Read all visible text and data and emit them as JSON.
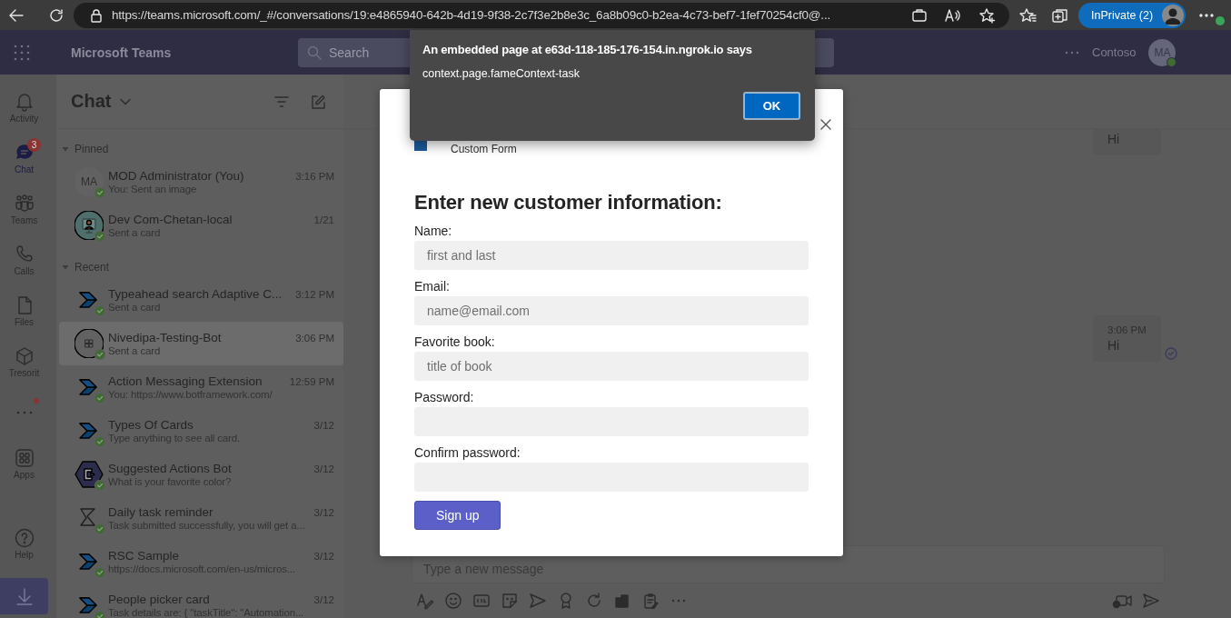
{
  "browser": {
    "url": "https://teams.microsoft.com/_#/conversations/19:e4865940-642b-4d19-9f38-2c7f3e2b8e3c_6a8b09c0-b2ea-4c73-bef7-1fef70254cf0@...",
    "profile_label": "InPrivate (2)"
  },
  "app_bar": {
    "title": "Microsoft Teams",
    "search_placeholder": "Search",
    "org": "Contoso",
    "avatar_initials": "MA",
    "online": true
  },
  "rail": [
    {
      "kind": "activity",
      "label": "Activity",
      "selected": false
    },
    {
      "kind": "chat",
      "label": "Chat",
      "selected": true,
      "badge": "3"
    },
    {
      "kind": "teams",
      "label": "Teams",
      "selected": false
    },
    {
      "kind": "calls",
      "label": "Calls",
      "selected": false
    },
    {
      "kind": "files",
      "label": "Files",
      "selected": false
    },
    {
      "kind": "tresorit",
      "label": "Tresorit",
      "selected": false
    },
    {
      "kind": "more",
      "notification": true
    },
    {
      "kind": "apps",
      "label": "Apps",
      "selected": false
    },
    {
      "kind": "help",
      "label": "Help",
      "selected": false
    },
    {
      "kind": "download"
    }
  ],
  "chat_list": {
    "title": "Chat",
    "sections": [
      {
        "label": "Pinned",
        "expanded": true,
        "chats": [
          {
            "name": "MOD Administrator (You)",
            "time": "3:16 PM",
            "preview": "You: Sent an image",
            "avatar": {
              "kind": "initials",
              "initials": "MA"
            },
            "online": true,
            "selected": false
          },
          {
            "name": "Dev Com-Chetan-local",
            "time": "1/21",
            "preview": "Sent a card",
            "avatar": {
              "kind": "person"
            },
            "online": true,
            "selected": false
          }
        ]
      },
      {
        "label": "Recent",
        "expanded": true,
        "chats": [
          {
            "name": "Typeahead search Adaptive C...",
            "time": "3:12 PM",
            "preview": "Sent a card",
            "avatar": {
              "kind": "chevron"
            },
            "online": true,
            "selected": false
          },
          {
            "name": "Nivedipa-Testing-Bot",
            "time": "3:06 PM",
            "preview": "Sent a card",
            "avatar": {
              "kind": "grid"
            },
            "online": true,
            "selected": true
          },
          {
            "name": "Action Messaging Extension",
            "time": "12:59 PM",
            "preview": "You: https://www.botframework.com/",
            "avatar": {
              "kind": "chevron"
            },
            "online": true,
            "selected": false
          },
          {
            "name": "Types Of Cards",
            "time": "3/12",
            "preview": "Type anything to see all card.",
            "avatar": {
              "kind": "chevron"
            },
            "online": true,
            "selected": false
          },
          {
            "name": "Suggested Actions Bot",
            "time": "3/12",
            "preview": "What is your favorite color?",
            "avatar": {
              "kind": "hexagon"
            },
            "online": true,
            "selected": false
          },
          {
            "name": "Daily task reminder",
            "time": "3/12",
            "preview": "Task submitted successfully, you will get a...",
            "avatar": {
              "kind": "hourglass"
            },
            "online": true,
            "selected": false
          },
          {
            "name": "RSC Sample",
            "time": "3/12",
            "preview": "https://docs.microsoft.com/en-us/micros...",
            "avatar": {
              "kind": "chevron"
            },
            "online": true,
            "selected": false
          },
          {
            "name": "People picker card",
            "time": "3/12",
            "preview": "Task details are: { \"taskTitle\": \"Automation...",
            "avatar": {
              "kind": "chevron"
            },
            "online": true,
            "selected": false
          }
        ]
      }
    ]
  },
  "messages": [
    {
      "text": "Hi",
      "read": false
    },
    {
      "time": "3:06 PM",
      "text": "Hi",
      "read": true
    }
  ],
  "compose": {
    "placeholder": "Type a new message"
  },
  "dialog": {
    "app_title": "Custom Form",
    "heading": "Enter new customer information:",
    "fields": [
      {
        "label": "Name:",
        "placeholder": "first and last"
      },
      {
        "label": "Email:",
        "placeholder": "name@email.com"
      },
      {
        "label": "Favorite book:",
        "placeholder": "title of book"
      },
      {
        "label": "Password:"
      },
      {
        "label": "Confirm password:"
      }
    ],
    "submit": "Sign up"
  },
  "alert": {
    "title": "An embedded page at e63d-118-185-176-154.in.ngrok.io says",
    "message": "context.page.fameContext-task",
    "button": "OK"
  }
}
